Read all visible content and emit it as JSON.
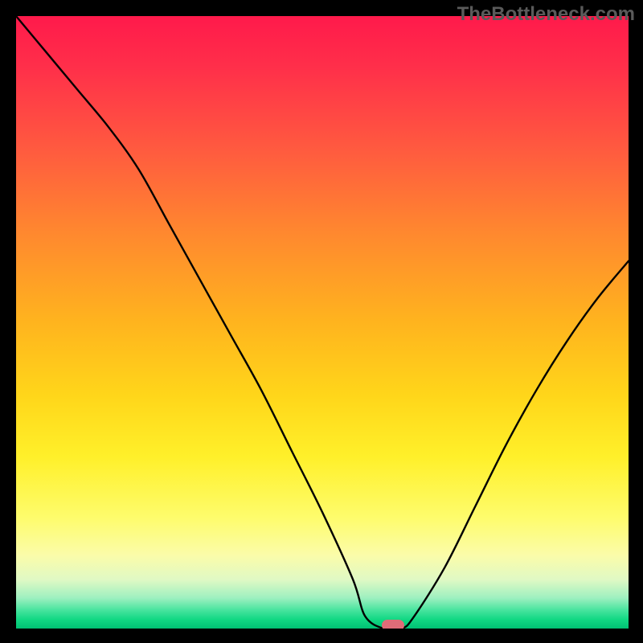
{
  "watermark": "TheBottleneck.com",
  "chart_data": {
    "type": "line",
    "title": "",
    "xlabel": "",
    "ylabel": "",
    "xlim": [
      0,
      100
    ],
    "ylim": [
      0,
      100
    ],
    "x": [
      0,
      5,
      10,
      15,
      20,
      25,
      30,
      35,
      40,
      45,
      50,
      55,
      57,
      60,
      63,
      65,
      70,
      75,
      80,
      85,
      90,
      95,
      100
    ],
    "values": [
      100,
      94,
      88,
      82,
      75,
      66,
      57,
      48,
      39,
      29,
      19,
      8,
      2,
      0,
      0,
      2,
      10,
      20,
      30,
      39,
      47,
      54,
      60
    ],
    "marker": {
      "x": 61.5,
      "y": 0
    },
    "gradient_stops": [
      {
        "pct": 0,
        "color": "#ff1a4b"
      },
      {
        "pct": 50,
        "color": "#ffd61a"
      },
      {
        "pct": 88,
        "color": "#fbfca9"
      },
      {
        "pct": 100,
        "color": "#00c173"
      }
    ]
  }
}
